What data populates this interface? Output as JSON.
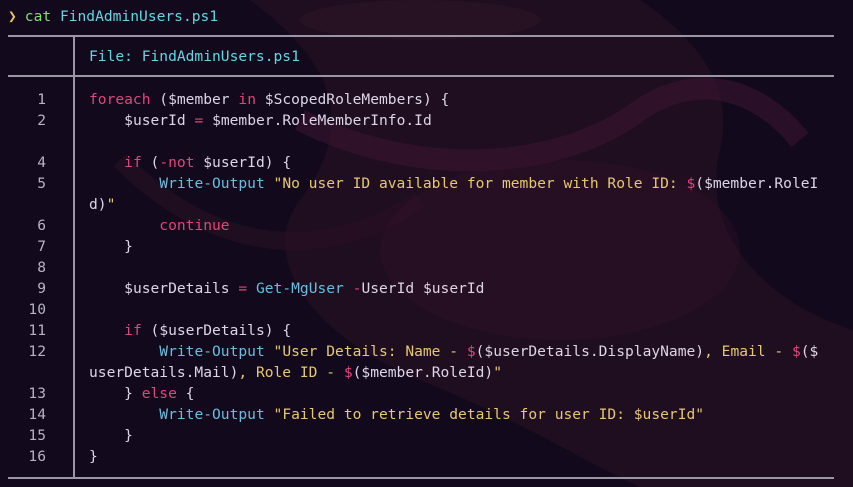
{
  "terminal": {
    "prompt_symbol": "❯",
    "command": "cat",
    "command_arg": "FindAdminUsers.ps1"
  },
  "viewer": {
    "file_header": "File: FindAdminUsers.ps1",
    "line_numbers": [
      "1",
      "2",
      "",
      "4",
      "5",
      "",
      "6",
      "7",
      "8",
      "9",
      "10",
      "11",
      "12",
      "",
      "13",
      "14",
      "15",
      "16"
    ],
    "lines": [
      [
        {
          "t": "kw",
          "s": "foreach"
        },
        {
          "t": "plain",
          "s": " ("
        },
        {
          "t": "var",
          "s": "$member"
        },
        {
          "t": "plain",
          "s": " "
        },
        {
          "t": "kw",
          "s": "in"
        },
        {
          "t": "plain",
          "s": " "
        },
        {
          "t": "var",
          "s": "$ScopedRoleMembers"
        },
        {
          "t": "plain",
          "s": ") {"
        }
      ],
      [
        {
          "t": "plain",
          "s": "    "
        },
        {
          "t": "var",
          "s": "$userId"
        },
        {
          "t": "plain",
          "s": " "
        },
        {
          "t": "op",
          "s": "="
        },
        {
          "t": "plain",
          "s": " "
        },
        {
          "t": "var",
          "s": "$member"
        },
        {
          "t": "plain",
          "s": ".RoleMemberInfo.Id"
        }
      ],
      [],
      [
        {
          "t": "plain",
          "s": "    "
        },
        {
          "t": "kw",
          "s": "if"
        },
        {
          "t": "plain",
          "s": " ("
        },
        {
          "t": "op",
          "s": "-not"
        },
        {
          "t": "plain",
          "s": " "
        },
        {
          "t": "var",
          "s": "$userId"
        },
        {
          "t": "plain",
          "s": ") {"
        }
      ],
      [
        {
          "t": "plain",
          "s": "        "
        },
        {
          "t": "cmdlet",
          "s": "Write-Output"
        },
        {
          "t": "plain",
          "s": " "
        },
        {
          "t": "str",
          "s": "\"No user ID available for member with Role ID: "
        },
        {
          "t": "op",
          "s": "$"
        },
        {
          "t": "plain",
          "s": "("
        },
        {
          "t": "var",
          "s": "$member"
        },
        {
          "t": "plain",
          "s": ".RoleI"
        }
      ],
      [
        {
          "t": "plain",
          "s": "d)"
        },
        {
          "t": "str",
          "s": "\""
        }
      ],
      [
        {
          "t": "plain",
          "s": "        "
        },
        {
          "t": "kw",
          "s": "continue"
        }
      ],
      [
        {
          "t": "plain",
          "s": "    }"
        }
      ],
      [],
      [
        {
          "t": "plain",
          "s": "    "
        },
        {
          "t": "var",
          "s": "$userDetails"
        },
        {
          "t": "plain",
          "s": " "
        },
        {
          "t": "op",
          "s": "="
        },
        {
          "t": "plain",
          "s": " "
        },
        {
          "t": "cmdlet",
          "s": "Get-MgUser"
        },
        {
          "t": "plain",
          "s": " "
        },
        {
          "t": "op",
          "s": "-"
        },
        {
          "t": "plain",
          "s": "UserId "
        },
        {
          "t": "var",
          "s": "$userId"
        }
      ],
      [],
      [
        {
          "t": "plain",
          "s": "    "
        },
        {
          "t": "kw",
          "s": "if"
        },
        {
          "t": "plain",
          "s": " ("
        },
        {
          "t": "var",
          "s": "$userDetails"
        },
        {
          "t": "plain",
          "s": ") {"
        }
      ],
      [
        {
          "t": "plain",
          "s": "        "
        },
        {
          "t": "cmdlet",
          "s": "Write-Output"
        },
        {
          "t": "plain",
          "s": " "
        },
        {
          "t": "str",
          "s": "\"User Details: Name - "
        },
        {
          "t": "op",
          "s": "$"
        },
        {
          "t": "plain",
          "s": "("
        },
        {
          "t": "var",
          "s": "$userDetails"
        },
        {
          "t": "plain",
          "s": ".DisplayName)"
        },
        {
          "t": "str",
          "s": ", Email - "
        },
        {
          "t": "op",
          "s": "$"
        },
        {
          "t": "plain",
          "s": "($"
        }
      ],
      [
        {
          "t": "plain",
          "s": "userDetails.Mail)"
        },
        {
          "t": "str",
          "s": ", Role ID - "
        },
        {
          "t": "op",
          "s": "$"
        },
        {
          "t": "plain",
          "s": "("
        },
        {
          "t": "var",
          "s": "$member"
        },
        {
          "t": "plain",
          "s": ".RoleId)"
        },
        {
          "t": "str",
          "s": "\""
        }
      ],
      [
        {
          "t": "plain",
          "s": "    } "
        },
        {
          "t": "kw",
          "s": "else"
        },
        {
          "t": "plain",
          "s": " {"
        }
      ],
      [
        {
          "t": "plain",
          "s": "        "
        },
        {
          "t": "cmdlet",
          "s": "Write-Output"
        },
        {
          "t": "plain",
          "s": " "
        },
        {
          "t": "str",
          "s": "\"Failed to retrieve details for user ID: $userId\""
        }
      ],
      [
        {
          "t": "plain",
          "s": "    }"
        }
      ],
      [
        {
          "t": "plain",
          "s": "}"
        }
      ]
    ]
  },
  "colors": {
    "background": "#12091c",
    "keyword": "#e2457a",
    "cmdlet": "#68bede",
    "string": "#e6c870",
    "text": "#ddd6e6",
    "border": "#9a96a4"
  }
}
